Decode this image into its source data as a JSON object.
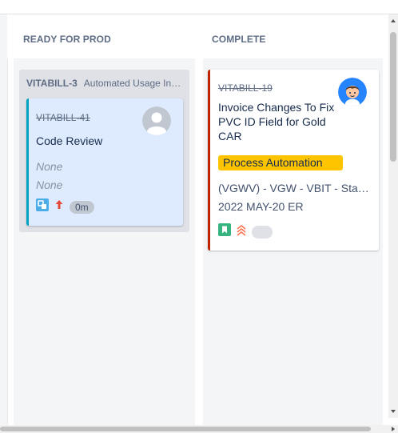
{
  "columns": {
    "ready": {
      "title": "READY FOR PROD"
    },
    "complete": {
      "title": "COMPLETE"
    }
  },
  "swimlane": {
    "key": "VITABILL-3",
    "summary": "Automated Usage Inquiry"
  },
  "cards": {
    "review": {
      "key": "VITABILL-41",
      "summary": "Code Review",
      "fields": [
        "None",
        "None"
      ],
      "time": "0m",
      "issue_type_icon": "subtask-icon",
      "priority_icon": "priority-high-arrow-icon",
      "accent_color": "#00a3bf"
    },
    "invoice": {
      "key": "VITABILL-19",
      "summary": "Invoice Changes To Fix PVC ID Field for Gold CAR",
      "epic": "Process Automation",
      "line1": "(VGWV) - VGW - VBIT - Status",
      "line2": "2022 MAY-20 ER",
      "issue_type_icon": "story-bookmark-icon",
      "priority_icon": "priority-highest-chevrons-icon",
      "accent_color": "#bf2600",
      "epic_color": "#ffc400"
    }
  }
}
